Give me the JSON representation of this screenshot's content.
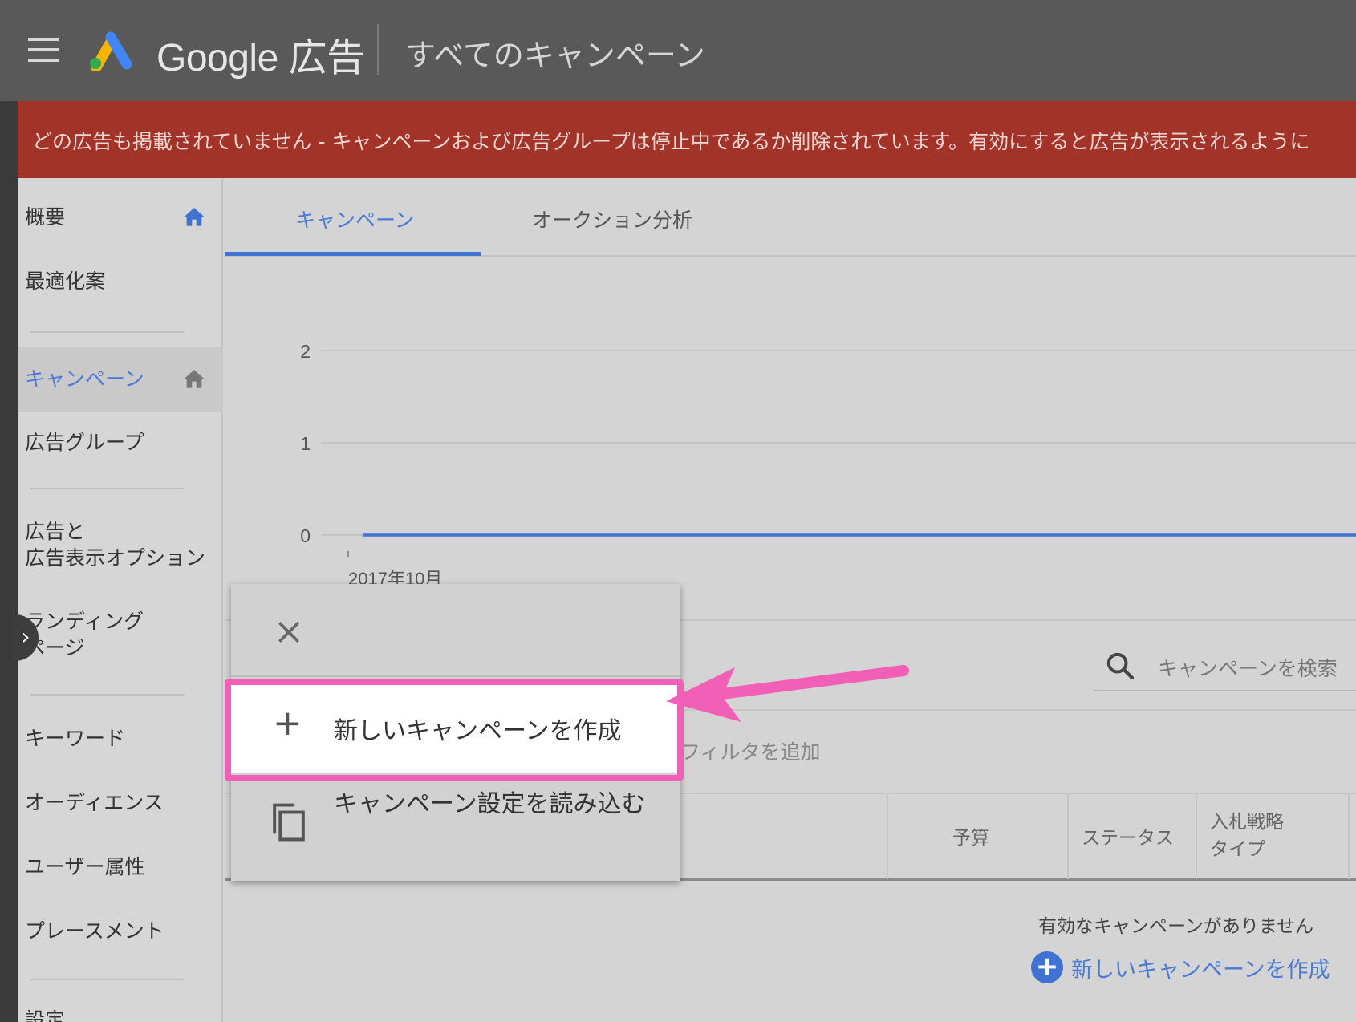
{
  "header": {
    "brand_name": "Google 広告",
    "page_title": "すべてのキャンペーン"
  },
  "alert": {
    "message": "どの広告も掲載されていません - キャンペーンおよび広告グループは停止中であるか削除されています。有効にすると広告が表示されるように"
  },
  "sidebar": {
    "items": [
      {
        "label": "概要",
        "icon": "home-icon"
      },
      {
        "label": "最適化案"
      },
      {
        "label": "キャンペーン",
        "icon": "home-icon",
        "active": true
      },
      {
        "label": "広告グループ"
      },
      {
        "label_line1": "広告と",
        "label_line2": "広告表示オプション"
      },
      {
        "label_line1": "ランディング",
        "label_line2": "ページ"
      },
      {
        "label": "キーワード"
      },
      {
        "label": "オーディエンス"
      },
      {
        "label": "ユーザー属性"
      },
      {
        "label": "プレースメント"
      },
      {
        "label": "設定"
      }
    ]
  },
  "tabs": [
    {
      "label": "キャンペーン",
      "active": true
    },
    {
      "label": "オークション分析"
    }
  ],
  "chart_data": {
    "type": "line",
    "x": [
      "2017年10月"
    ],
    "series": [
      {
        "values": [
          0
        ]
      }
    ],
    "y_ticks": [
      "0",
      "1",
      "2"
    ],
    "ylim": [
      0,
      2
    ],
    "grid": true,
    "color": "#3f72d1"
  },
  "table": {
    "search_placeholder": "キャンペーンを検索",
    "add_filter": "フィルタを追加",
    "columns": [
      {
        "label": "予算"
      },
      {
        "label": "ステータス"
      },
      {
        "label_line1": "入札戦略",
        "label_line2": "タイプ"
      }
    ],
    "empty_message": "有効なキャンペーンがありません",
    "create_link": "新しいキャンペーンを作成"
  },
  "menu": {
    "create_new": "新しいキャンペーンを作成",
    "load_settings": "キャンペーン設定を読み込む"
  },
  "colors": {
    "accent": "#3f72d1",
    "alert_bg": "#a23328",
    "highlight": "#f25fb7"
  }
}
